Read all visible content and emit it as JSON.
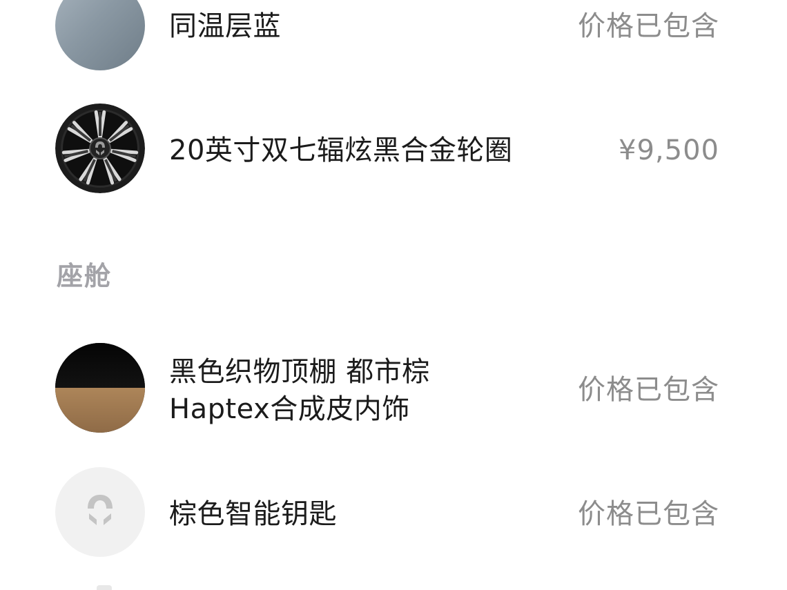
{
  "exterior": {
    "items": [
      {
        "name": "同温层蓝",
        "price": "价格已包含",
        "icon": "paint-swatch"
      },
      {
        "name": "20英寸双七辐炫黑合金轮圈",
        "price": "¥9,500",
        "icon": "wheel-rim-icon"
      }
    ]
  },
  "cabin": {
    "section_title": "座舱",
    "items": [
      {
        "name_line1": "黑色织物顶棚 都市棕",
        "name_line2": "Haptex合成皮内饰",
        "price": "价格已包含",
        "icon": "interior-swatch"
      },
      {
        "name": "棕色智能钥匙",
        "price": "价格已包含",
        "icon": "nio-logo-icon"
      }
    ]
  },
  "colors": {
    "text_primary": "#1b1b1b",
    "text_secondary": "#8c8c8c",
    "section_title": "#a3a3a8",
    "paint_blue_gray": "#8a98a3",
    "interior_brown": "#9c7750"
  }
}
